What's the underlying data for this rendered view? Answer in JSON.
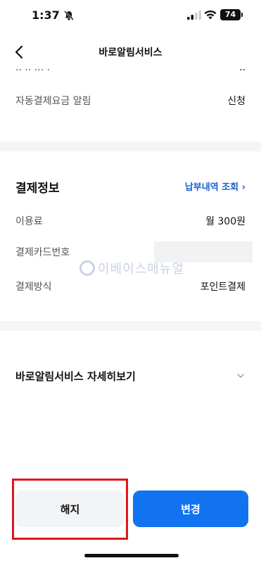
{
  "status_bar": {
    "time": "1:37",
    "battery": "74"
  },
  "nav": {
    "title": "바로알림서비스"
  },
  "top_rows": [
    {
      "label": "자동결제요금 알림",
      "value": "신청"
    }
  ],
  "payment": {
    "title": "결제정보",
    "history_link": "납부내역 조회",
    "rows": [
      {
        "label": "이용료",
        "value": "월 300원"
      },
      {
        "label": "결제카드번호",
        "value": ""
      },
      {
        "label": "결제방식",
        "value": "포인트결제"
      }
    ]
  },
  "watermark": "이베이스매뉴얼",
  "details": {
    "label": "바로알림서비스 자세히보기"
  },
  "actions": {
    "cancel": "해지",
    "change": "변경"
  },
  "colors": {
    "primary": "#1273f0",
    "link": "#1a5fd0",
    "highlight": "#e0141b"
  }
}
